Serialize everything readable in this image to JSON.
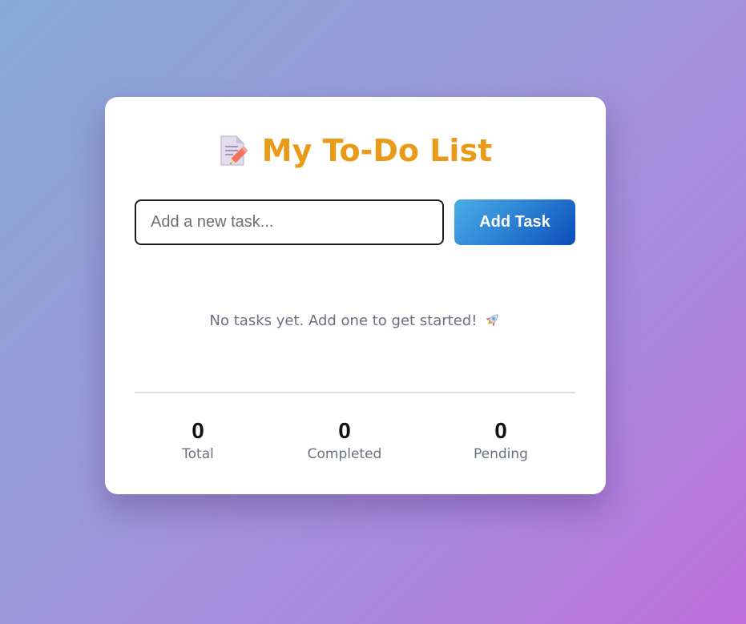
{
  "app": {
    "title": "My To-Do List",
    "title_icon": "memo-pencil-icon",
    "title_color": "#e99a18"
  },
  "input": {
    "value": "",
    "placeholder": "Add a new task..."
  },
  "add_button": {
    "label": "Add Task"
  },
  "empty_state": {
    "message": "No tasks yet. Add one to get started!",
    "icon": "rocket-icon"
  },
  "stats": {
    "total": {
      "value": "0",
      "label": "Total"
    },
    "completed": {
      "value": "0",
      "label": "Completed"
    },
    "pending": {
      "value": "0",
      "label": "Pending"
    }
  },
  "colors": {
    "accent": "#e99a18",
    "button_start": "#4aaee6",
    "button_end": "#0a4cb8",
    "background_start": "#86a9d8",
    "background_end": "#bf6edc"
  }
}
